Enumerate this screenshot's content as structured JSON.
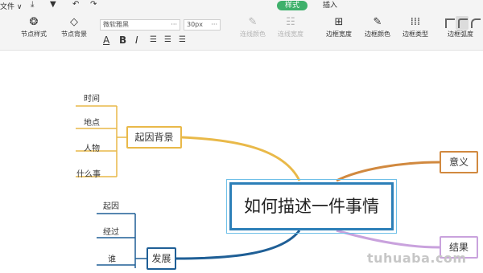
{
  "topbar": {
    "file_menu": "文件 ∨",
    "tabs": [
      {
        "label": "样式",
        "active": true
      },
      {
        "label": "插入",
        "active": false
      }
    ],
    "accent_color": "#3fb06b"
  },
  "toolbar": {
    "node_style": "节点样式",
    "node_background": "节点背景",
    "font_family": "微软雅黑",
    "font_size": "30px",
    "bold": "B",
    "italic": "I",
    "underline": "A",
    "line_color": "连线颜色",
    "line_width": "连线宽度",
    "border_width": "边框宽度",
    "border_color": "边框颜色",
    "border_type": "边框类型",
    "border_radius": "边框弧度"
  },
  "mindmap": {
    "central_topic": "如何描述一件事情",
    "branches": {
      "background": {
        "label": "起因背景",
        "color": "#e9b949",
        "children": [
          "时间",
          "地点",
          "人物",
          "什么事"
        ]
      },
      "development": {
        "label": "发展",
        "color": "#1f5f96",
        "children": [
          "起因",
          "经过",
          "谁"
        ]
      },
      "meaning": {
        "label": "意义",
        "color": "#d1893f"
      },
      "result": {
        "label": "结果",
        "color": "#c9a2dd"
      }
    }
  },
  "watermark": "tuhuaba.com"
}
